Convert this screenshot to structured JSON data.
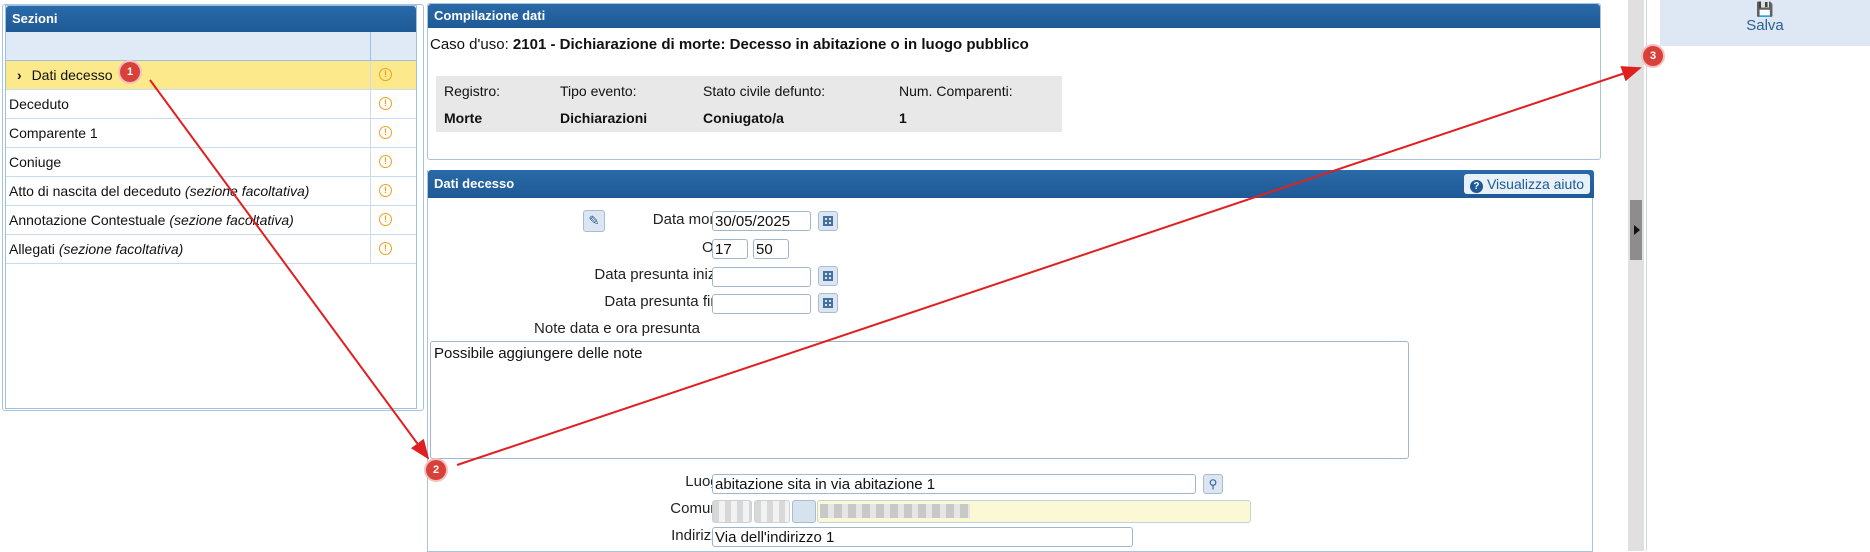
{
  "sezioni": {
    "title": "Sezioni",
    "items": [
      {
        "prefix": "›",
        "label": "Dati decesso",
        "suffix": ""
      },
      {
        "label": "Deceduto",
        "suffix": ""
      },
      {
        "label": "Comparente 1",
        "suffix": ""
      },
      {
        "label": "Coniuge",
        "suffix": ""
      },
      {
        "label": "Atto di nascita del deceduto ",
        "suffix": "(sezione facoltativa)"
      },
      {
        "label": "Annotazione Contestuale ",
        "suffix": "(sezione facoltativa)"
      },
      {
        "label": "Allegati ",
        "suffix": "(sezione facoltativa)"
      }
    ],
    "warning_icon": "!"
  },
  "compilazione": {
    "title": "Compilazione dati",
    "caso_label": "Caso d'uso: ",
    "caso_value": "2101 - Dichiarazione di morte: Decesso in abitazione o in luogo pubblico",
    "info": {
      "registro_label": "Registro:",
      "registro_value": "Morte",
      "tipo_label": "Tipo evento:",
      "tipo_value": "Dichiarazioni",
      "stato_label": "Stato civile defunto:",
      "stato_value": "Coniugato/a",
      "num_label": "Num. Comparenti:",
      "num_value": "1"
    }
  },
  "dati_decesso": {
    "title": "Dati decesso",
    "help_label": "Visualizza aiuto",
    "data_morte_label": "Data morte",
    "data_morte_value": "30/05/2025",
    "ora_label": "Ora",
    "ora_h": "17",
    "ora_m": "50",
    "data_inizio_label": "Data presunta inizio",
    "data_fine_label": "Data presunta fine",
    "note_label": "Note data e ora presunta",
    "note_value": "Possibile aggiungere delle note",
    "luogo_label": "Luogo",
    "luogo_value": "abitazione sita in via abitazione 1",
    "comune_label": "Comune",
    "indirizzo_label": "Indirizzo",
    "indirizzo_value": "Via dell'indirizzo 1"
  },
  "toolbar": {
    "salva_label": "Salva"
  },
  "markers": [
    "1",
    "2",
    "3"
  ],
  "colors": {
    "header_blue": "#1e5a96",
    "active_row": "#fbe98c",
    "warning": "#f0a020",
    "marker_red": "#d8413a"
  }
}
